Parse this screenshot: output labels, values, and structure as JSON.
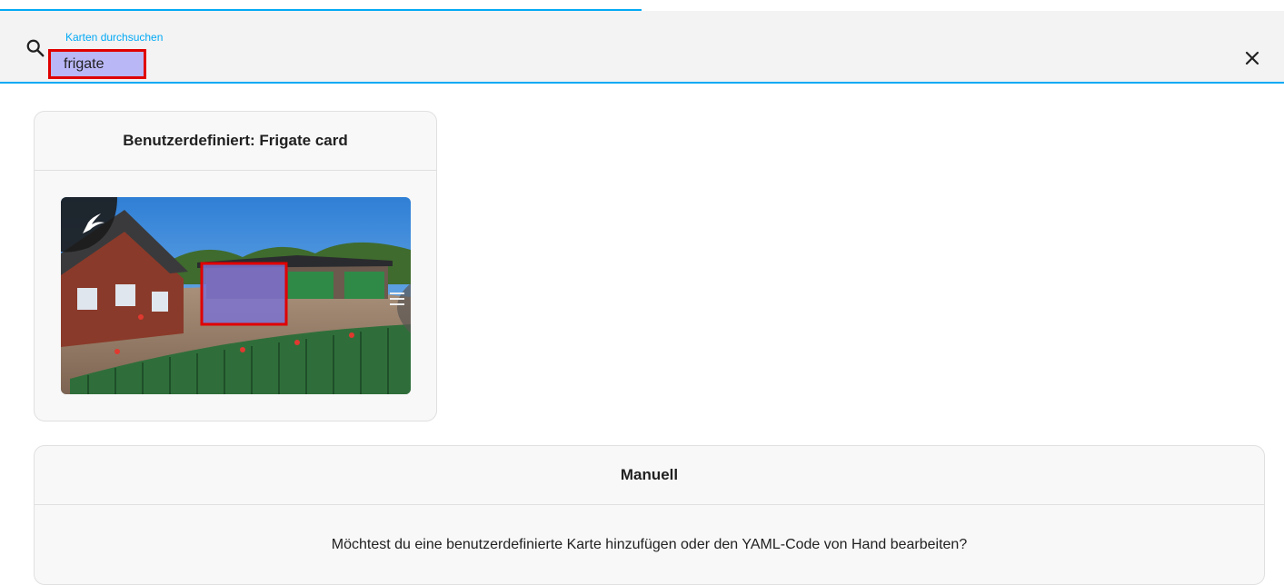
{
  "search": {
    "label": "Karten durchsuchen",
    "value": "frigate"
  },
  "cards": {
    "frigate": {
      "title": "Benutzerdefiniert: Frigate card",
      "preview_logo_icon": "frigate-bird-icon"
    },
    "manual": {
      "title": "Manuell",
      "description": "Möchtest du eine benutzerdefinierte Karte hinzufügen oder den YAML-Code von Hand bearbeiten?"
    }
  },
  "icons": {
    "search": "search-icon",
    "clear": "close-icon"
  },
  "colors": {
    "accent": "#03a9f4",
    "highlight_border": "#e00000",
    "highlight_fill": "#b9b7f6"
  }
}
